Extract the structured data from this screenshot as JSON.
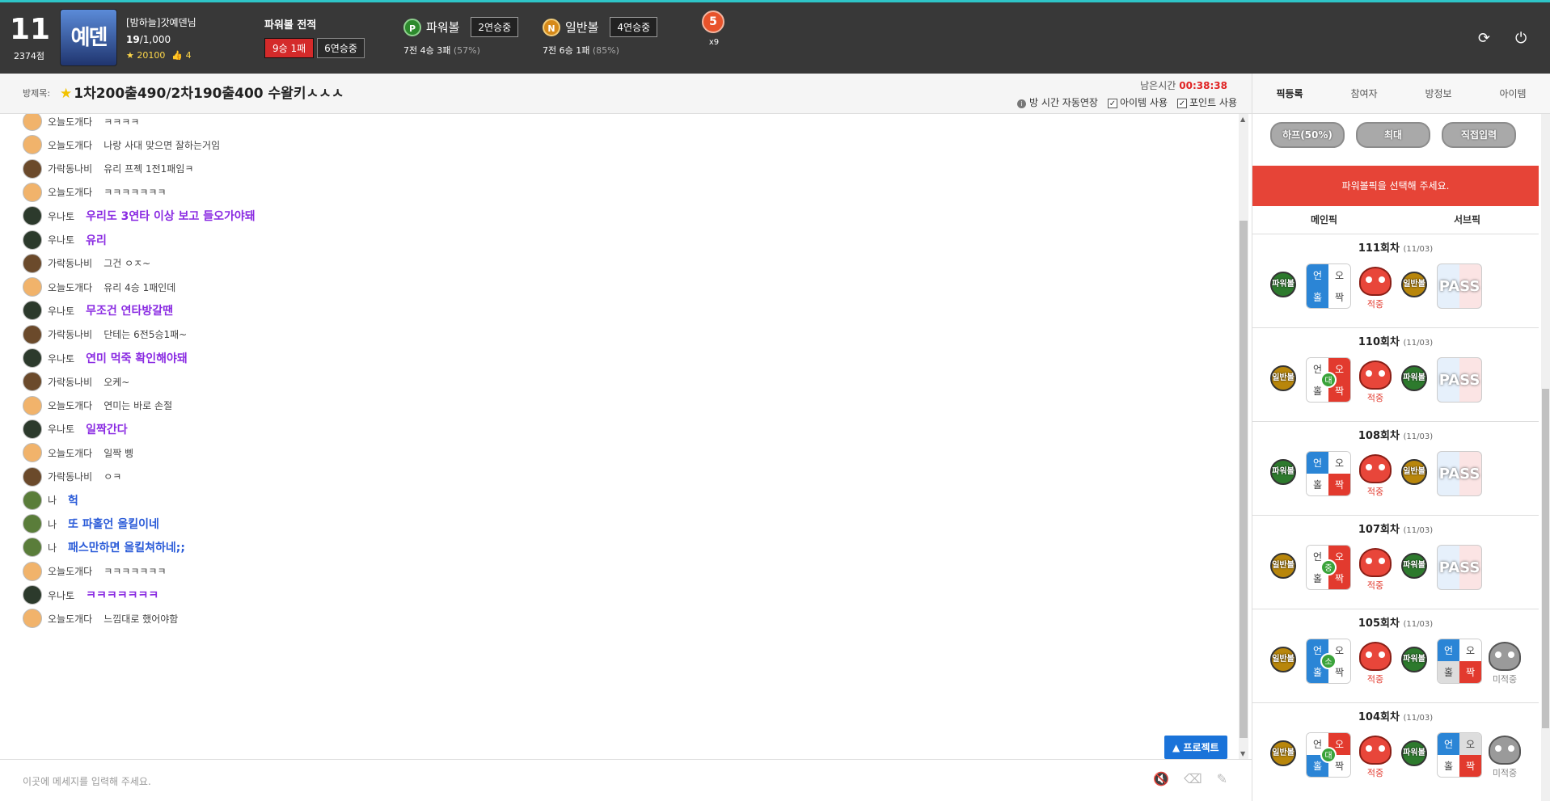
{
  "user": {
    "level": "11",
    "points": "2374점",
    "avatar_text": "예덴",
    "name": "[밤하늘]갓예덴님",
    "rank": "19",
    "rank_total": "/1,000",
    "stars": "20100",
    "likes": "4"
  },
  "record": {
    "title": "파워볼 전적",
    "badge1": "9승 1패",
    "badge2": "6연승중"
  },
  "powerball": {
    "icon": "P",
    "label": "파워볼",
    "streak": "2연승중",
    "record": "7전 4승 3패",
    "pct": "(57%)"
  },
  "normalball": {
    "icon": "N",
    "label": "일반볼",
    "streak": "4연승중",
    "record": "7전 6승 1패",
    "pct": "(85%)"
  },
  "medal": {
    "value": "5",
    "multiplier": "x9"
  },
  "room": {
    "label": "방제목:",
    "title": "1차200출490/2차190출400 수왈키ㅅㅅㅅ",
    "remain_label": "남은시간",
    "remain_time": "00:38:38",
    "opt_extend": "방 시간 자동연장",
    "opt_item": "아이템 사용",
    "opt_point": "포인트 사용"
  },
  "messages": [
    {
      "name": "오늘도개다",
      "text": "ㅋㅋㅋㅋ",
      "style": "",
      "av": "#f1b36b"
    },
    {
      "name": "오늘도개다",
      "text": "나랑 사대 맞으면 잘하는거임",
      "style": "",
      "av": "#f1b36b"
    },
    {
      "name": "가락동나비",
      "text": "유리 프젝 1전1패임ㅋ",
      "style": "",
      "av": "#6b4a2b"
    },
    {
      "name": "오늘도개다",
      "text": "ㅋㅋㅋㅋㅋㅋㅋ",
      "style": "",
      "av": "#f1b36b"
    },
    {
      "name": "우나토",
      "text": "우리도 3연타 이상 보고 들오가야돼",
      "style": "purple",
      "av": "#2c3a2c"
    },
    {
      "name": "우나토",
      "text": "유리",
      "style": "purple",
      "av": "#2c3a2c"
    },
    {
      "name": "가락동나비",
      "text": "그건 ㅇㅈ~",
      "style": "",
      "av": "#6b4a2b"
    },
    {
      "name": "오늘도개다",
      "text": "유리 4승 1패인데",
      "style": "",
      "av": "#f1b36b"
    },
    {
      "name": "우나토",
      "text": "무조건 연타방갈땐",
      "style": "purple",
      "av": "#2c3a2c"
    },
    {
      "name": "가락동나비",
      "text": "단테는 6전5승1패~",
      "style": "",
      "av": "#6b4a2b"
    },
    {
      "name": "우나토",
      "text": "연미 먹죽 확인해야돼",
      "style": "purple",
      "av": "#2c3a2c"
    },
    {
      "name": "가락동나비",
      "text": "오케~",
      "style": "",
      "av": "#6b4a2b"
    },
    {
      "name": "오늘도개다",
      "text": "연미는 바로 손절",
      "style": "",
      "av": "#f1b36b"
    },
    {
      "name": "우나토",
      "text": "일짝간다",
      "style": "purple",
      "av": "#2c3a2c"
    },
    {
      "name": "오늘도개다",
      "text": "일짝 삥",
      "style": "",
      "av": "#f1b36b"
    },
    {
      "name": "가락동나비",
      "text": "ㅇㅋ",
      "style": "",
      "av": "#6b4a2b"
    },
    {
      "name": "나",
      "text": "헉",
      "style": "blue",
      "av": "#5a7d3a"
    },
    {
      "name": "나",
      "text": "또 파홀언 올킬이네",
      "style": "blue",
      "av": "#5a7d3a"
    },
    {
      "name": "나",
      "text": "패스만하면 올킬쳐하네;;",
      "style": "blue",
      "av": "#5a7d3a"
    },
    {
      "name": "오늘도개다",
      "text": "ㅋㅋㅋㅋㅋㅋㅋ",
      "style": "",
      "av": "#f1b36b"
    },
    {
      "name": "우나토",
      "text": "ㅋㅋㅋㅋㅋㅋㅋ",
      "style": "purple",
      "av": "#2c3a2c"
    },
    {
      "name": "오늘도개다",
      "text": "느낌대로 했어야함",
      "style": "",
      "av": "#f1b36b"
    }
  ],
  "protect_label": "프로젝트",
  "input_placeholder": "이곳에 메세지를 입력해 주세요.",
  "tabs": [
    "픽등록",
    "참여자",
    "방정보",
    "아이템"
  ],
  "bet_buttons": [
    "하프(50%)",
    "최대",
    "직접입력"
  ],
  "alert": "파워볼픽을 선택해 주세요.",
  "col_main": "메인픽",
  "col_sub": "서브픽",
  "rounds": [
    {
      "round": "111회차",
      "date": "(11/03)",
      "main_coin": "파워볼",
      "main_type": "pw",
      "main": [
        "b:언",
        "w:오",
        "b:홀",
        "w:짝"
      ],
      "main_mini": "",
      "hit": "적중",
      "sub_coin": "일반볼",
      "sub_type": "nb",
      "sub": "PASS",
      "sub_hit": ""
    },
    {
      "round": "110회차",
      "date": "(11/03)",
      "main_coin": "일반볼",
      "main_type": "nb",
      "main": [
        "w:언",
        "r:오",
        "w:홀",
        "r:짝"
      ],
      "main_mini": "대",
      "hit": "적중",
      "sub_coin": "파워볼",
      "sub_type": "pw",
      "sub": "PASS",
      "sub_hit": ""
    },
    {
      "round": "108회차",
      "date": "(11/03)",
      "main_coin": "파워볼",
      "main_type": "pw",
      "main": [
        "b:언",
        "w:오",
        "w:홀",
        "r:짝"
      ],
      "main_mini": "",
      "hit": "적중",
      "sub_coin": "일반볼",
      "sub_type": "nb",
      "sub": "PASS",
      "sub_hit": ""
    },
    {
      "round": "107회차",
      "date": "(11/03)",
      "main_coin": "일반볼",
      "main_type": "nb",
      "main": [
        "w:언",
        "r:오",
        "w:홀",
        "r:짝"
      ],
      "main_mini": "중",
      "hit": "적중",
      "sub_coin": "파워볼",
      "sub_type": "pw",
      "sub": "PASS",
      "sub_hit": ""
    },
    {
      "round": "105회차",
      "date": "(11/03)",
      "main_coin": "일반볼",
      "main_type": "nb",
      "main": [
        "b:언",
        "w:오",
        "b:홀",
        "w:짝"
      ],
      "main_mini": "소",
      "hit": "적중",
      "sub_coin": "파워볼",
      "sub_type": "pw",
      "sub": [
        "b:언",
        "w:오",
        "g:홀",
        "r:짝"
      ],
      "sub_hit": "미적중"
    },
    {
      "round": "104회차",
      "date": "(11/03)",
      "main_coin": "일반볼",
      "main_type": "nb",
      "main": [
        "w:언",
        "r:오",
        "b:홀",
        "w:짝"
      ],
      "main_mini": "대",
      "hit": "적중",
      "sub_coin": "파워볼",
      "sub_type": "pw",
      "sub": [
        "b:언",
        "g:오",
        "w:홀",
        "r:짝"
      ],
      "sub_hit": "미적중"
    }
  ],
  "colors": {
    "accent_red": "#e64437",
    "blue": "#2b85d6",
    "header": "#383838",
    "teal": "#2ec5c8"
  }
}
